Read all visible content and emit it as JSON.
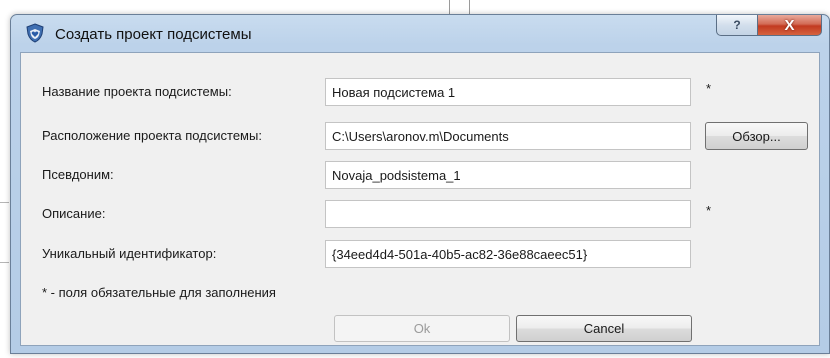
{
  "dialog": {
    "title": "Создать проект подсистемы",
    "help_label": "?",
    "close_label": "X"
  },
  "form": {
    "name_label": "Название проекта подсистемы:",
    "name_value": "Новая подсистема 1",
    "location_label": "Расположение проекта подсистемы:",
    "location_value": "C:\\Users\\aronov.m\\Documents",
    "alias_label": "Псевдоним:",
    "alias_value": "Novaja_podsistema_1",
    "description_label": "Описание:",
    "description_value": "",
    "uid_label": "Уникальный идентификатор:",
    "uid_value": "{34eed4d4-501a-40b5-ac82-36e88caeec51}",
    "required_mark": "*",
    "required_note": "* - поля обязательные для заполнения"
  },
  "buttons": {
    "browse_label": "Обзор...",
    "ok_label": "Ok",
    "cancel_label": "Cancel",
    "ok_enabled": false
  },
  "icons": {
    "app": "shield-heart-icon"
  },
  "colors": {
    "close_button": "#c7402a",
    "frame": "#bcd2ea",
    "client": "#f0f0f0"
  }
}
